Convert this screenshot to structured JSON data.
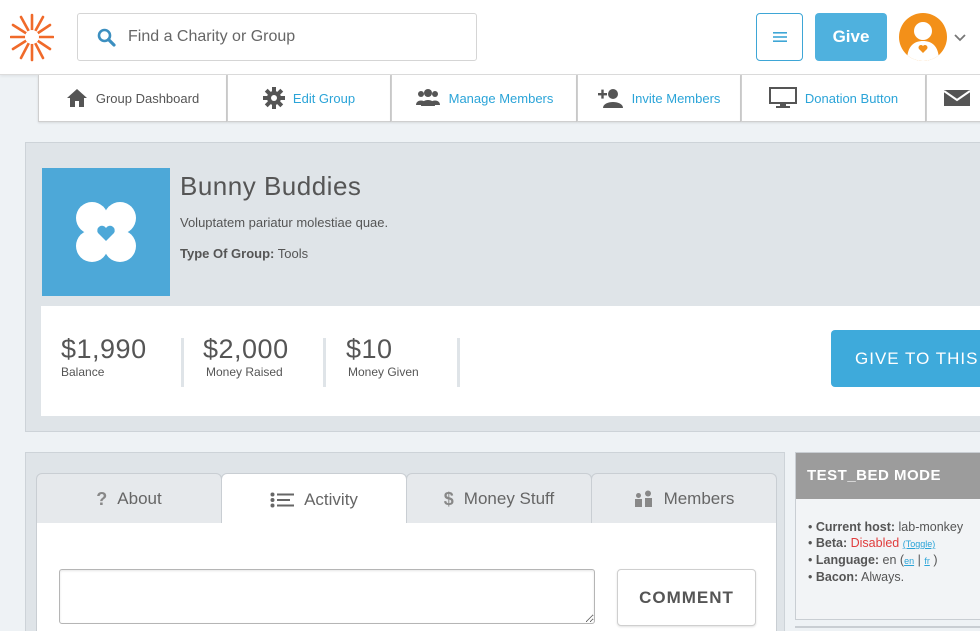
{
  "header": {
    "search_placeholder": "Find a Charity or Group",
    "give_label": "Give",
    "accent": "#4fb1de",
    "avatar_color": "#f39019"
  },
  "group_nav": [
    {
      "label": "Group Dashboard",
      "icon": "house-icon"
    },
    {
      "label": "Edit Group",
      "icon": "gear-icon"
    },
    {
      "label": "Manage Members",
      "icon": "people-icon"
    },
    {
      "label": "Invite Members",
      "icon": "add-user-icon"
    },
    {
      "label": "Donation Button",
      "icon": "monitor-icon"
    },
    {
      "label": "",
      "icon": "envelope-icon"
    }
  ],
  "group": {
    "name": "Bunny Buddies",
    "description": "Voluptatem pariatur molestiae quae.",
    "type_label": "Type Of Group:",
    "type_value": "Tools",
    "logo_color": "#4da8d8"
  },
  "stats": [
    {
      "amount": "$1,990",
      "label": "Balance"
    },
    {
      "amount": "$2,000",
      "label": "Money Raised"
    },
    {
      "amount": "$10",
      "label": "Money Given"
    }
  ],
  "give_to_this_label": "GIVE TO THIS",
  "content_tabs": [
    {
      "label": "About",
      "icon": "question-icon"
    },
    {
      "label": "Activity",
      "icon": "list-icon"
    },
    {
      "label": "Money Stuff",
      "icon": "dollar-icon"
    },
    {
      "label": "Members",
      "icon": "members-icon"
    }
  ],
  "comment": {
    "value": "",
    "button_label": "COMMENT"
  },
  "test_bed": {
    "title": "TEST_BED MODE",
    "host_label": "Current host:",
    "host_value": "lab-monkey",
    "beta_label": "Beta:",
    "beta_value": "Disabled",
    "beta_toggle": "(Toggle)",
    "language_label": "Language:",
    "language_value": "en (",
    "lang_en": "en",
    "lang_sep": "|",
    "lang_fr": "fr",
    "lang_close": ")",
    "bacon_label": "Bacon:",
    "bacon_value": "Always."
  }
}
